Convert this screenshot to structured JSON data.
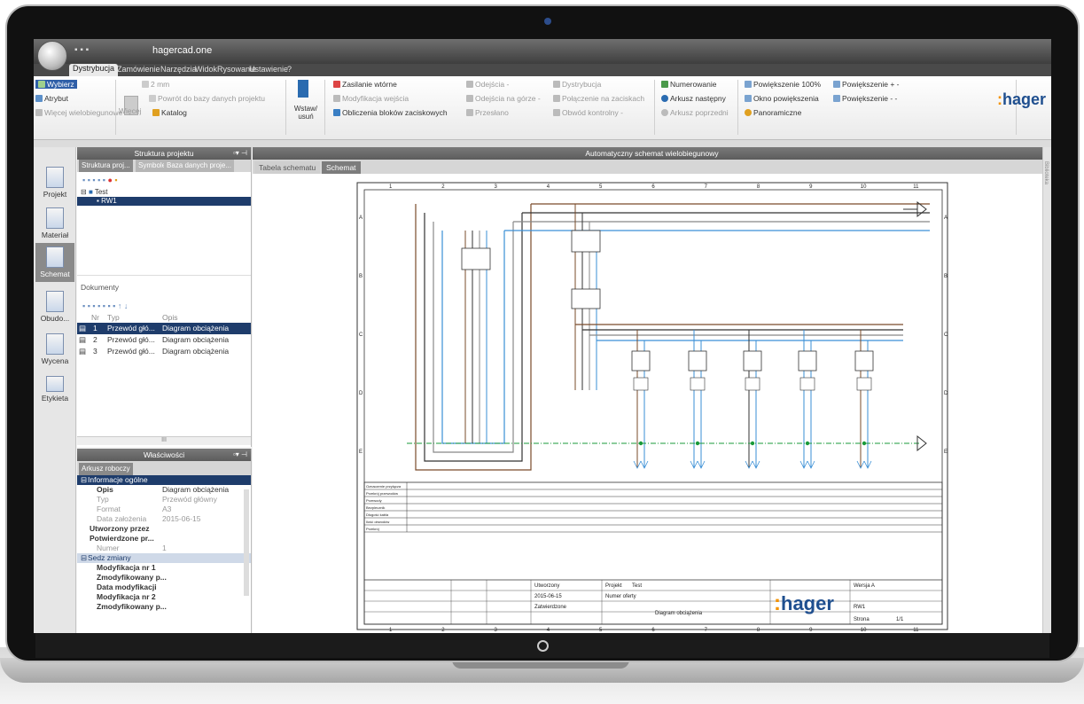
{
  "app": {
    "title": "hagercad.one",
    "quick_access": "▪ ▪ ▪"
  },
  "menu": [
    "Dystrybucja",
    "Zamówienie",
    "Narzędzia",
    "Widok",
    "Rysowanie",
    "Ustawienie",
    "?"
  ],
  "ribbon": {
    "group1": [
      "Wybierz",
      "Atrybut",
      "Więcej wielobiegunowe"
    ],
    "group2": [
      "2 mm",
      "Powrót do bazy danych projektu",
      "Więcej",
      "Katalog"
    ],
    "insert_remove": "Wstaw/ usuń",
    "group3": [
      "Zasilanie wtórne",
      "Modyfikacja wejścia",
      "Obliczenia bloków zaciskowych"
    ],
    "group4": [
      "Odejścia",
      "Odejścia na górze",
      "Przesłano"
    ],
    "group5": [
      "Dystrybucja",
      "Połączenie na zaciskach",
      "Obwód kontrolny"
    ],
    "group6": [
      "Numerowanie",
      "Arkusz następny",
      "Arkusz poprzedni"
    ],
    "group7": [
      "Powiększenie 100%",
      "Okno powiększenia",
      "Panoramiczne"
    ],
    "group8": [
      "Powiększenie +",
      "Powiększenie -"
    ],
    "logo": {
      "brand": "hager",
      "accent": "#f39200",
      "color": "#1f4f8f"
    }
  },
  "left_tools": [
    "Projekt",
    "Materiał",
    "Schemat",
    "Obudo...",
    "Wycena",
    "Etykieta"
  ],
  "project_panel": {
    "title": "Struktura projektu",
    "tabs": [
      "Struktura proj...",
      "Symbole",
      "Baza danych proje..."
    ],
    "tree": [
      {
        "label": "Test"
      },
      {
        "label": "RW1"
      }
    ],
    "documents_title": "Dokumenty",
    "doc_columns": [
      "Nr",
      "Typ",
      "Opis"
    ],
    "documents": [
      {
        "nr": "1",
        "typ": "Przewód głó...",
        "opis": "Diagram obciążenia"
      },
      {
        "nr": "2",
        "typ": "Przewód głó...",
        "opis": "Diagram obciążenia"
      },
      {
        "nr": "3",
        "typ": "Przewód głó...",
        "opis": "Diagram obciążenia"
      }
    ],
    "scroll_label": "III"
  },
  "properties_panel": {
    "title": "Właściwości",
    "tab": "Arkusz roboczy",
    "section1": "Informacje ogólne",
    "rows": [
      {
        "k": "Opis",
        "v": "Diagram obciążenia"
      },
      {
        "k": "Typ",
        "v": "Przewód główny"
      },
      {
        "k": "Format",
        "v": "A3"
      },
      {
        "k": "Data założenia",
        "v": "2015-06-15"
      },
      {
        "k": "Utworzony przez",
        "v": ""
      },
      {
        "k": "Potwierdzone pr...",
        "v": ""
      },
      {
        "k": "Numer",
        "v": "1"
      }
    ],
    "section2": "Sedz zmiany",
    "rows2": [
      "Modyfikacja nr 1",
      "Zmodyfikowany p...",
      "Data modyfikacji",
      "Modyfikacja nr 2",
      "Zmodyfikowany p..."
    ]
  },
  "main_panel": {
    "title": "Automatyczny schemat wielobiegunowy",
    "tabs": [
      "Tabela schematu",
      "Schemat"
    ],
    "right_tab": "Biblioteka"
  },
  "schematic": {
    "col_numbers": [
      "1",
      "2",
      "3",
      "4",
      "5",
      "6",
      "7",
      "8",
      "9",
      "10",
      "11"
    ],
    "row_letters": [
      "A",
      "B",
      "C",
      "D",
      "E"
    ],
    "title_block": {
      "project_label": "Projekt",
      "project_value": "Test",
      "offer_label": "Numer oferty",
      "description": "Diagram obciążenia",
      "brand": "hager",
      "sheet_label": "Strona",
      "sheet_value": "1/1",
      "version": "Wersja A",
      "rw": "RW1",
      "date": "2015-06-15",
      "created": "Utworzony",
      "approved": "Zatwierdzone"
    },
    "legend_labels": [
      "Oznaczenie przyłącza",
      "Przekrój przewodów",
      "Przewody",
      "Bezpiecznik",
      "Długość kabla",
      "Ilość obwodów",
      "Przekrój"
    ]
  }
}
